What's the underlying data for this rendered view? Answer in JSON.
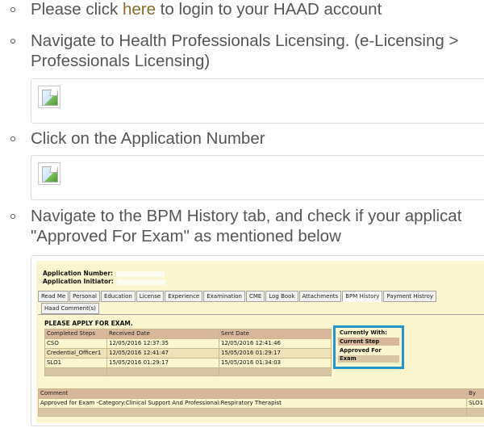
{
  "instructions": {
    "step1": {
      "prefix": "Please click ",
      "link": "here",
      "suffix": " to login to your HAAD account"
    },
    "step2": {
      "line1": "Navigate to Health Professionals Licensing. (e-Licensing >",
      "line2": "Professionals Licensing)"
    },
    "step3": {
      "text": "Click on the Application Number"
    },
    "step4": {
      "line1": "Navigate to the BPM History tab, and check if your applicat",
      "line2": "\"Approved For Exam\" as mentioned below"
    }
  },
  "portal": {
    "application_number_label": "Application Number:",
    "application_initiator_label": "Application Initiator:",
    "tabs": [
      "Read Me",
      "Personal",
      "Education",
      "License",
      "Experience",
      "Examination",
      "CME",
      "Log Book",
      "Attachments",
      "BPM History",
      "Payment Histroy"
    ],
    "active_tab": "BPM History",
    "second_tab": "Haad Comment(s)",
    "apply_message": "PLEASE APPLY FOR EXAM.",
    "steps_table": {
      "headers": [
        "Completed Steps",
        "Received Date",
        "Sent Date"
      ],
      "rows": [
        [
          "CSO",
          "12/05/2016 12:37:35",
          "12/05/2016 12:41:46"
        ],
        [
          "Credential_Officer1",
          "12/05/2016 12:41:47",
          "15/05/2016 01:29:17"
        ],
        [
          "SLO1",
          "15/05/2016 01:29:17",
          "15/05/2016 01:34:03"
        ]
      ]
    },
    "current_with": {
      "label": "Currently With:",
      "step_header": "Current Step",
      "step_value": "Approved For Exam"
    },
    "comment_table": {
      "headers": [
        "Comment",
        "By"
      ],
      "row": [
        "Approved for Exam -Category:Clinical Support And Professional:Respiratory Therapist",
        "SLO1"
      ]
    }
  },
  "icons": {
    "broken_image": "broken-image-icon",
    "bullet": "hollow-circle-bullet"
  },
  "colors": {
    "link": "#8a6a2a",
    "highlight_border": "#2596c9",
    "portal_bg": "#fbf6cf"
  }
}
